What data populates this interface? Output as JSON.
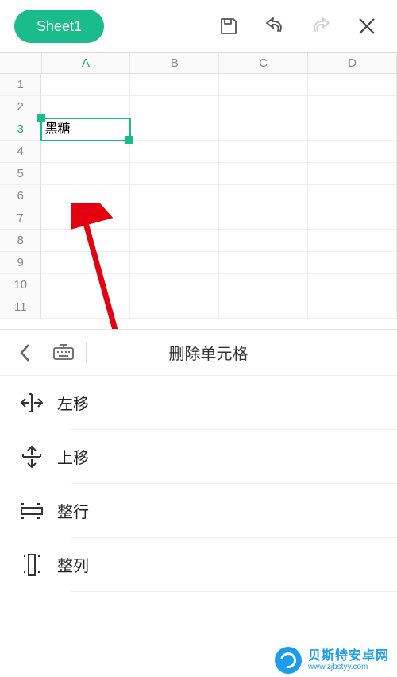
{
  "toolbar": {
    "sheet_tab": "Sheet1"
  },
  "grid": {
    "columns": [
      "A",
      "B",
      "C",
      "D"
    ],
    "rows": [
      "1",
      "2",
      "3",
      "4",
      "5",
      "6",
      "7",
      "8",
      "9",
      "10",
      "11"
    ],
    "selected_col": "A",
    "selected_row": "3",
    "selected_cell_value": "黑糖"
  },
  "panel": {
    "title": "删除单元格",
    "options": [
      {
        "key": "shift-left",
        "label": "左移"
      },
      {
        "key": "shift-up",
        "label": "上移"
      },
      {
        "key": "entire-row",
        "label": "整行"
      },
      {
        "key": "entire-col",
        "label": "整列"
      }
    ]
  },
  "watermark": {
    "name": "贝斯特安卓网",
    "url": "www.zjbstyy.com"
  }
}
